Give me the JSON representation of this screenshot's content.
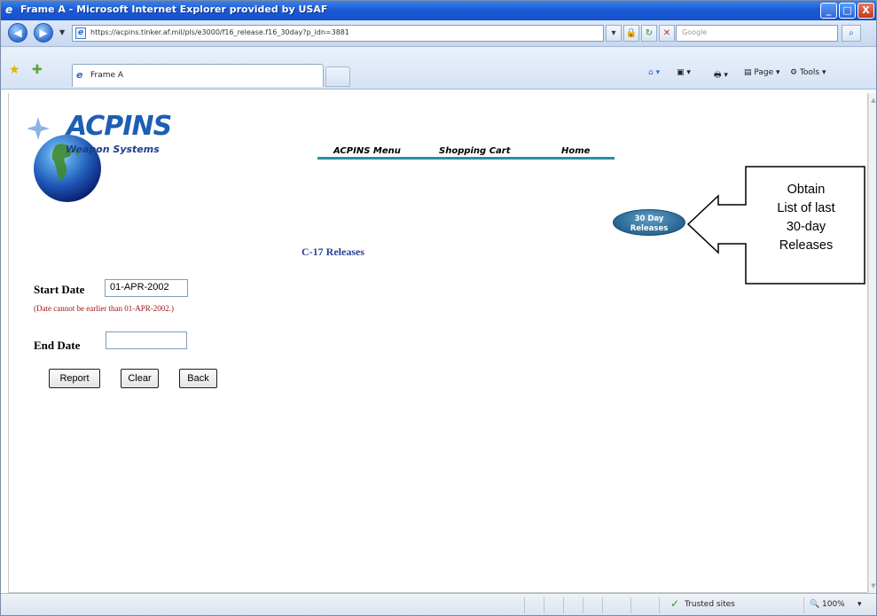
{
  "window": {
    "title": "Frame A - Microsoft Internet Explorer provided by USAF",
    "minimize_glyph": "_",
    "maximize_glyph": "□",
    "close_glyph": "X"
  },
  "address": {
    "url": "https://acpins.tinker.af.mil/pls/e3000/f16_release.f16_30day?p_idn=3881",
    "search_placeholder": "Google"
  },
  "tab": {
    "label": "Frame A"
  },
  "commands": {
    "page": "Page",
    "tools": "Tools"
  },
  "logo": {
    "name": "ACPINS",
    "subtitle": "Weapon Systems"
  },
  "nav": {
    "menu": "ACPINS Menu",
    "cart": "Shopping Cart",
    "home": "Home"
  },
  "releases_button": {
    "line1": "30 Day",
    "line2": "Releases"
  },
  "page": {
    "heading": "C-17 Releases",
    "start_label": "Start Date",
    "start_value": "01-APR-2002",
    "hint": "(Date cannot be earlier than 01-APR-2002.)",
    "end_label": "End Date",
    "end_value": ""
  },
  "buttons": {
    "report": "Report",
    "clear": "Clear",
    "back": "Back"
  },
  "callout": {
    "line1": "Obtain",
    "line2": "List of last",
    "line3": "30-day",
    "line4": "Releases"
  },
  "status": {
    "zone": "Trusted sites",
    "zoom": "100%"
  },
  "colors": {
    "accent": "#1c5fb3",
    "nav_line": "#2a8fa0",
    "heading": "#2a3e95",
    "hint": "#a31414"
  }
}
